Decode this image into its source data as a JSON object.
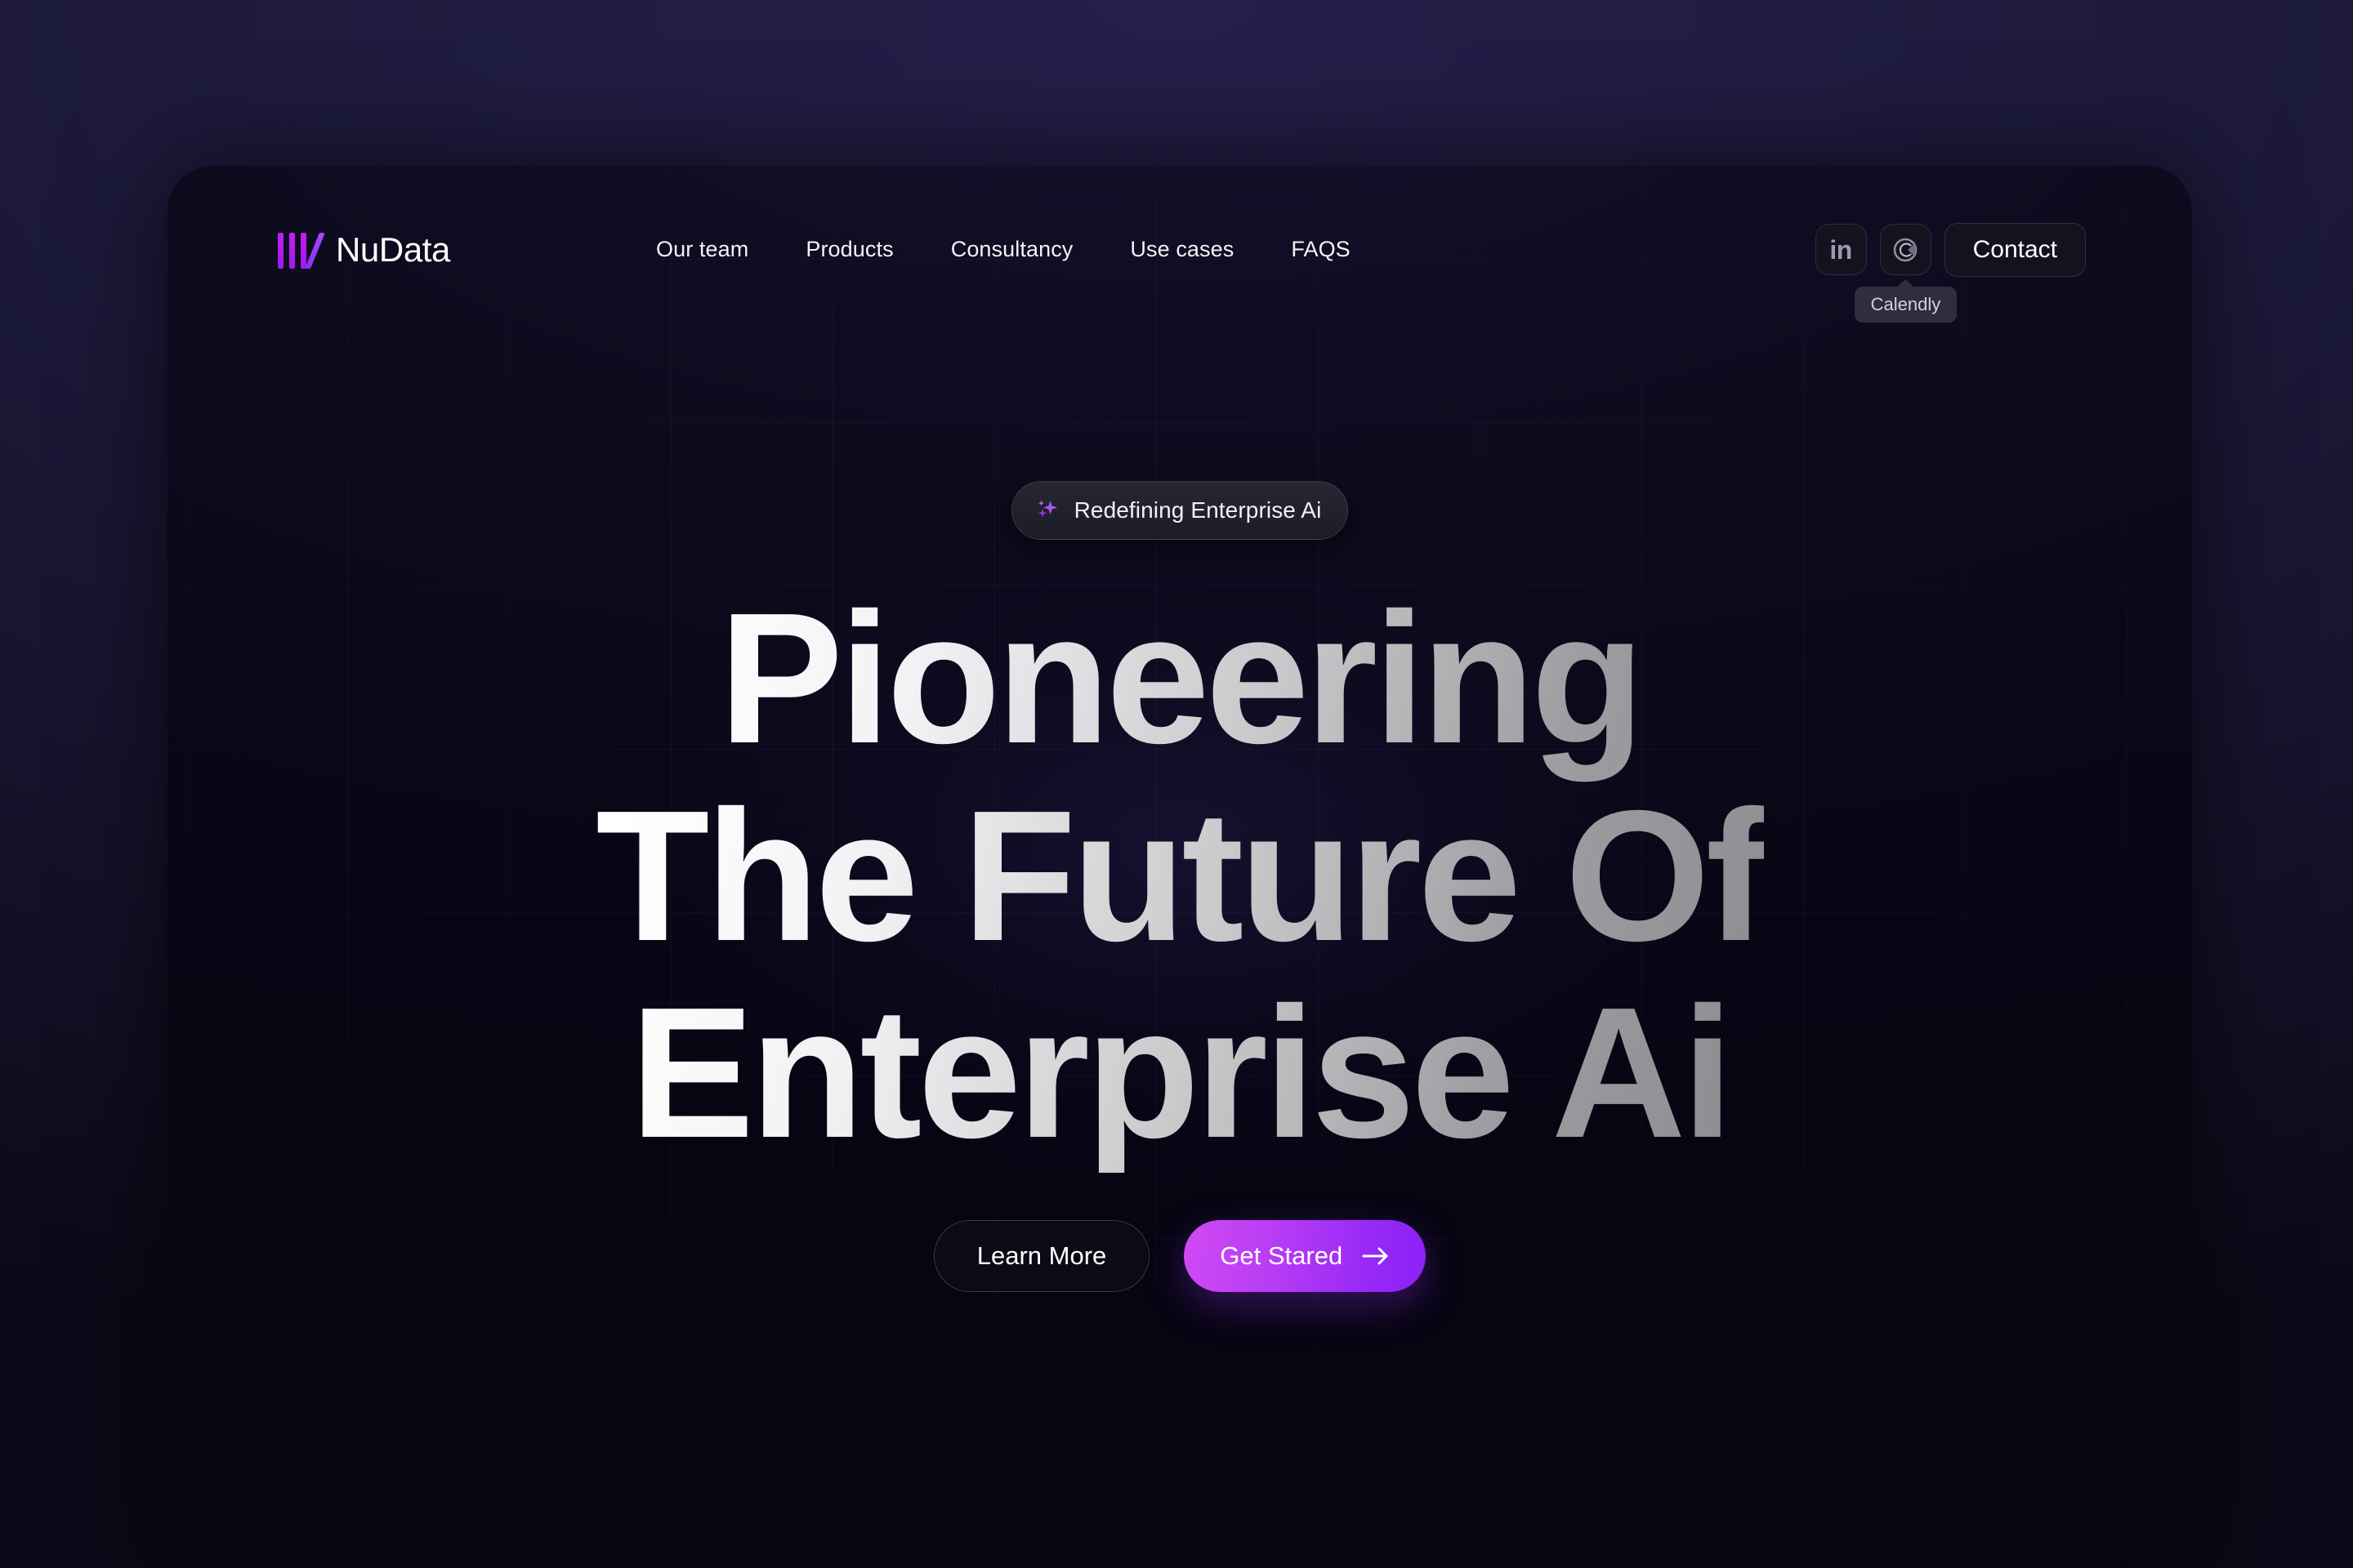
{
  "brand": {
    "name": "NuData",
    "mark_icon": "three-bars-slash-logo-icon"
  },
  "nav": {
    "items": [
      {
        "label": "Our team"
      },
      {
        "label": "Products"
      },
      {
        "label": "Consultancy"
      },
      {
        "label": "Use cases"
      },
      {
        "label": "FAQS"
      }
    ]
  },
  "header_actions": {
    "linkedin_icon": "linkedin-icon",
    "linkedin_glyph": "in",
    "calendly_icon": "calendly-icon",
    "contact_label": "Contact",
    "tooltip_label": "Calendly"
  },
  "hero": {
    "badge": {
      "icon": "sparkles-icon",
      "label": "Redefining Enterprise Ai"
    },
    "headline": "Pioneering\nThe Future Of\nEnterprise Ai",
    "primary_cta": {
      "label": "Get Stared",
      "icon": "arrow-right-icon"
    },
    "secondary_cta": {
      "label": "Learn More"
    }
  },
  "colors": {
    "accent_purple": "#a117f0",
    "accent_magenta": "#cf4af2",
    "accent_violet": "#8b20f7",
    "page_background": "#1d1a3c",
    "card_background": "#06040f",
    "text_primary": "#ffffff",
    "text_muted": "#9b9bab",
    "tooltip_background": "#2e2e3e"
  }
}
